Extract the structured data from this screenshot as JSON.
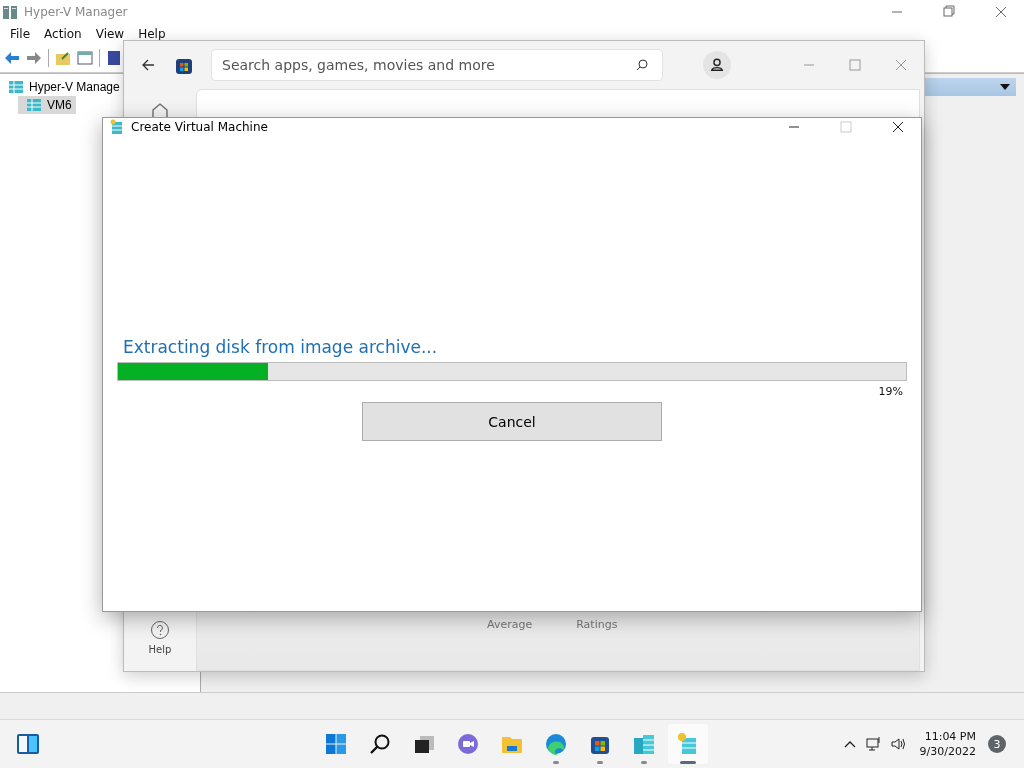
{
  "hyperv": {
    "title": "Hyper-V Manager",
    "menu": [
      "File",
      "Action",
      "View",
      "Help"
    ],
    "tree": [
      {
        "label": "Hyper-V Manage",
        "selected": false,
        "children": [
          {
            "label": "VM6",
            "selected": true
          }
        ]
      }
    ]
  },
  "store": {
    "search": {
      "placeholder": "Search apps, games, movies and more"
    },
    "help_label": "Help",
    "peek_labels": [
      "Average",
      "Ratings"
    ]
  },
  "dialog": {
    "title": "Create Virtual Machine",
    "maximize_disabled": true,
    "message": "Extracting disk from image archive...",
    "progress": {
      "level": 0.19,
      "reading": "19%"
    },
    "button": "Cancel"
  },
  "taskbar": {
    "apps": [
      {
        "kind": "start",
        "running": false,
        "selected": false
      },
      {
        "kind": "search",
        "running": false,
        "selected": false
      },
      {
        "kind": "taskview",
        "running": false,
        "selected": false
      },
      {
        "kind": "chat",
        "running": false,
        "selected": false
      },
      {
        "kind": "explorer",
        "running": false,
        "selected": false
      },
      {
        "kind": "edge",
        "running": true,
        "selected": false
      },
      {
        "kind": "store",
        "running": true,
        "selected": false
      },
      {
        "kind": "hyperv",
        "running": true,
        "selected": false
      },
      {
        "kind": "vmcreate",
        "running": true,
        "selected": true
      }
    ],
    "clock": {
      "time": "11:04 PM",
      "date": "9/30/2022"
    },
    "notifications": "3"
  }
}
